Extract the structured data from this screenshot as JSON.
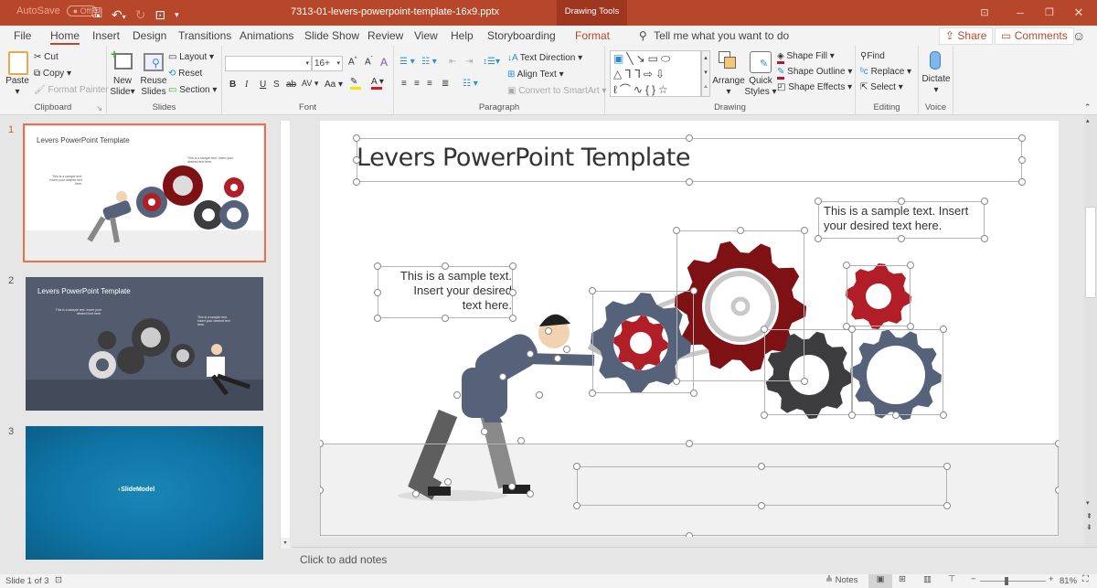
{
  "titlebar": {
    "autosave_label": "AutoSave",
    "autosave_state": "Off",
    "doc_title": "7313-01-levers-powerpoint-template-16x9.pptx",
    "context_tab": "Drawing Tools",
    "buttons": {
      "save": "save-icon",
      "undo": "undo-icon",
      "redo": "redo-icon",
      "present": "present-icon"
    }
  },
  "menu": {
    "tabs": [
      {
        "label": "File"
      },
      {
        "label": "Home",
        "active": true
      },
      {
        "label": "Insert"
      },
      {
        "label": "Design"
      },
      {
        "label": "Transitions"
      },
      {
        "label": "Animations"
      },
      {
        "label": "Slide Show"
      },
      {
        "label": "Review"
      },
      {
        "label": "View"
      },
      {
        "label": "Help"
      },
      {
        "label": "Storyboarding"
      },
      {
        "label": "Format"
      }
    ],
    "tell_me": "Tell me what you want to do",
    "share": "Share",
    "comments": "Comments"
  },
  "ribbon": {
    "clipboard": {
      "label": "Clipboard",
      "paste": "Paste",
      "cut": "Cut",
      "copy": "Copy",
      "format_painter": "Format Painter"
    },
    "slides": {
      "label": "Slides",
      "new_slide_1": "New",
      "new_slide_2": "Slide",
      "reuse_1": "Reuse",
      "reuse_2": "Slides",
      "layout": "Layout",
      "reset": "Reset",
      "section": "Section"
    },
    "font": {
      "label": "Font",
      "font_name": "",
      "font_size": "16+",
      "bold": "B",
      "italic": "I",
      "underline": "U",
      "shadow": "S",
      "strike": "ab",
      "spacing": "AV",
      "case": "Aa",
      "highlight_color": "#f5e30a",
      "font_color": "#e0161f"
    },
    "paragraph": {
      "label": "Paragraph",
      "text_direction": "Text Direction",
      "align_text": "Align Text",
      "smartart": "Convert to SmartArt"
    },
    "drawing": {
      "label": "Drawing",
      "arrange": "Arrange",
      "quick_1": "Quick",
      "quick_2": "Styles",
      "shape_fill": "Shape Fill",
      "shape_outline": "Shape Outline",
      "shape_effects": "Shape Effects"
    },
    "editing": {
      "label": "Editing",
      "find": "Find",
      "replace": "Replace",
      "select": "Select"
    },
    "voice": {
      "label": "Voice",
      "dictate": "Dictate"
    }
  },
  "slides_panel": {
    "slides": [
      {
        "number": "1",
        "title": "Levers PowerPoint Template",
        "text_a": "This is a sample text. Insert your desired text here.",
        "text_b": "This is a sample text. Insert your desired text here.",
        "selected": true
      },
      {
        "number": "2",
        "title": "Levers PowerPoint Template",
        "text_a": "This is a sample text. Insert your desired text here.",
        "text_b": "This is a sample text. Insert your desired text here."
      },
      {
        "number": "3",
        "logo": "SlideModel"
      }
    ]
  },
  "slide": {
    "title": "Levers PowerPoint Template",
    "text_left_1": "This is a sample text.",
    "text_left_2": "Insert your desired",
    "text_left_3": "text here.",
    "text_right_1": "This is a sample text. Insert",
    "text_right_2": "your desired text here.",
    "colors": {
      "dark_red": "#7d1114",
      "red": "#b21e27",
      "slate": "#56627a",
      "charcoal": "#3d3d3f",
      "silver": "#c8c8c8"
    }
  },
  "notes": {
    "placeholder": "Click to add notes"
  },
  "status": {
    "slide_info": "Slide 1 of 3",
    "notes_label": "Notes",
    "zoom": "81%",
    "zoom_percent": 81
  }
}
